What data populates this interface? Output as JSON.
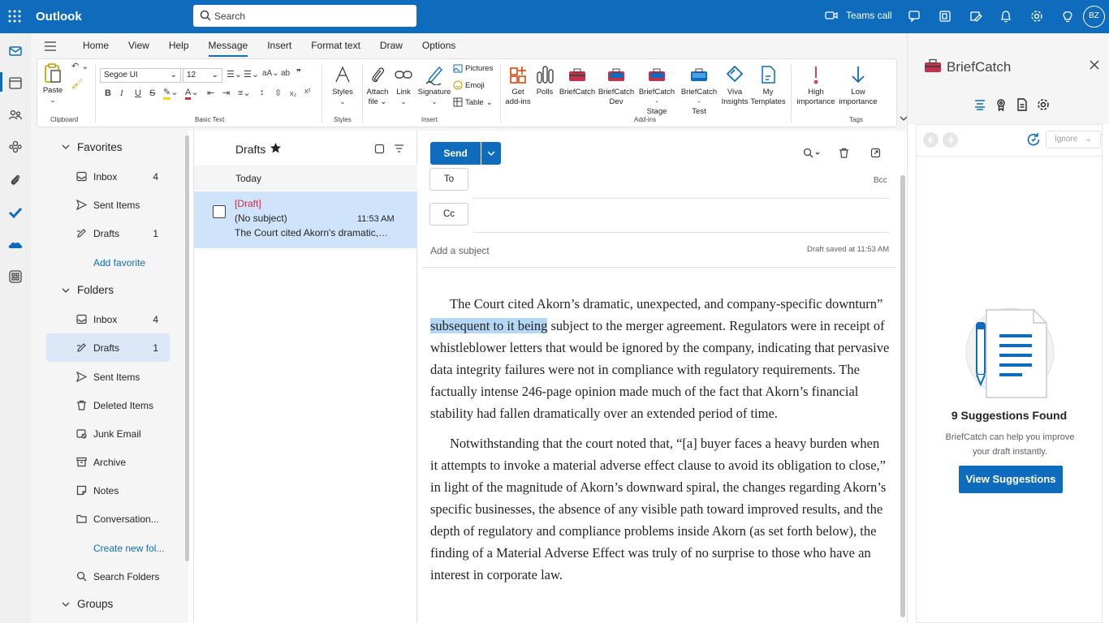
{
  "topbar": {
    "app_title": "Outlook",
    "search_placeholder": "Search",
    "teams_call": "Teams call",
    "avatar_initials": "BZ"
  },
  "ribbon": {
    "tabs": [
      "Home",
      "View",
      "Help",
      "Message",
      "Insert",
      "Format text",
      "Draw",
      "Options"
    ],
    "active_tab": "Message",
    "groups": {
      "clipboard": "Clipboard",
      "basic_text": "Basic Text",
      "styles": "Styles",
      "insert": "Insert",
      "addins": "Add-ins",
      "tags": "Tags"
    },
    "paste": "Paste",
    "font_name": "Segoe UI",
    "font_size": "12",
    "styles_btn": "Styles",
    "attach": [
      "Attach",
      "file"
    ],
    "link": "Link",
    "signature": "Signature",
    "pictures": "Pictures",
    "emoji": "Emoji",
    "table": "Table",
    "get_addins": [
      "Get",
      "add-ins"
    ],
    "polls": "Polls",
    "briefcatch": "BriefCatch",
    "briefcatch_dev": [
      "BriefCatch",
      "Dev"
    ],
    "briefcatch_stage": [
      "BriefCatch -",
      "Stage"
    ],
    "briefcatch_test": [
      "BriefCatch -",
      "Test"
    ],
    "viva": [
      "Viva",
      "Insights"
    ],
    "templates": [
      "My",
      "Templates"
    ],
    "high": [
      "High",
      "importance"
    ],
    "low": [
      "Low",
      "importance"
    ]
  },
  "folders": {
    "favorites_header": "Favorites",
    "favorites": [
      {
        "label": "Inbox",
        "count": "4"
      },
      {
        "label": "Sent Items",
        "count": ""
      },
      {
        "label": "Drafts",
        "count": "1"
      }
    ],
    "add_favorite": "Add favorite",
    "folders_header": "Folders",
    "items": [
      {
        "label": "Inbox",
        "count": "4"
      },
      {
        "label": "Drafts",
        "count": "1"
      },
      {
        "label": "Sent Items",
        "count": ""
      },
      {
        "label": "Deleted Items",
        "count": ""
      },
      {
        "label": "Junk Email",
        "count": ""
      },
      {
        "label": "Archive",
        "count": ""
      },
      {
        "label": "Notes",
        "count": ""
      },
      {
        "label": "Conversation...",
        "count": ""
      }
    ],
    "create_new": "Create new fol...",
    "search_folders": "Search Folders",
    "groups_header": "Groups"
  },
  "message_list": {
    "title": "Drafts",
    "group": "Today",
    "item": {
      "tag": "[Draft]",
      "subject": "(No subject)",
      "time": "11:53 AM",
      "preview": "The Court cited Akorn's dramatic, unexpected..."
    }
  },
  "compose": {
    "send": "Send",
    "to": "To",
    "cc": "Cc",
    "bcc": "Bcc",
    "subject_placeholder": "Add a subject",
    "saved": "Draft saved at 11:53 AM",
    "p1_a": "The Court cited Akorn’s dramatic, unexpected, and company-specific downturn” ",
    "p1_hl": "subsequent to it being",
    "p1_b": " subject to the merger agreement. Regulators were in receipt of whistleblower letters that would be ignored by the company, indicating that pervasive data integrity failures were not in compliance with regulatory requirements. The factually intense 246-page opinion made much of the fact that Akorn’s financial stability had fallen dramatically over an extended period of time.",
    "p2": "Notwithstanding that the court noted that, “[a] buyer faces a heavy burden when it attempts to invoke a material adverse effect clause to avoid its obligation to close,” in light of the magnitude of Akorn’s downward spiral, the changes regarding Akorn’s specific businesses, the absence of any visible path toward improved results, and the depth of regulatory and compliance problems inside Akorn (as set forth below), the finding of a Material Adverse Effect was truly of no surprise to those who have an interest in corporate law."
  },
  "briefcatch": {
    "title": "BriefCatch",
    "ignore": "Ignore",
    "found": "9 Suggestions Found",
    "desc": "BriefCatch can help you improve your draft instantly.",
    "button": "View Suggestions"
  },
  "colors": {
    "brand": "#0f6cbd",
    "selection": "#cfe4fa",
    "draft_tag": "#c4314b"
  }
}
